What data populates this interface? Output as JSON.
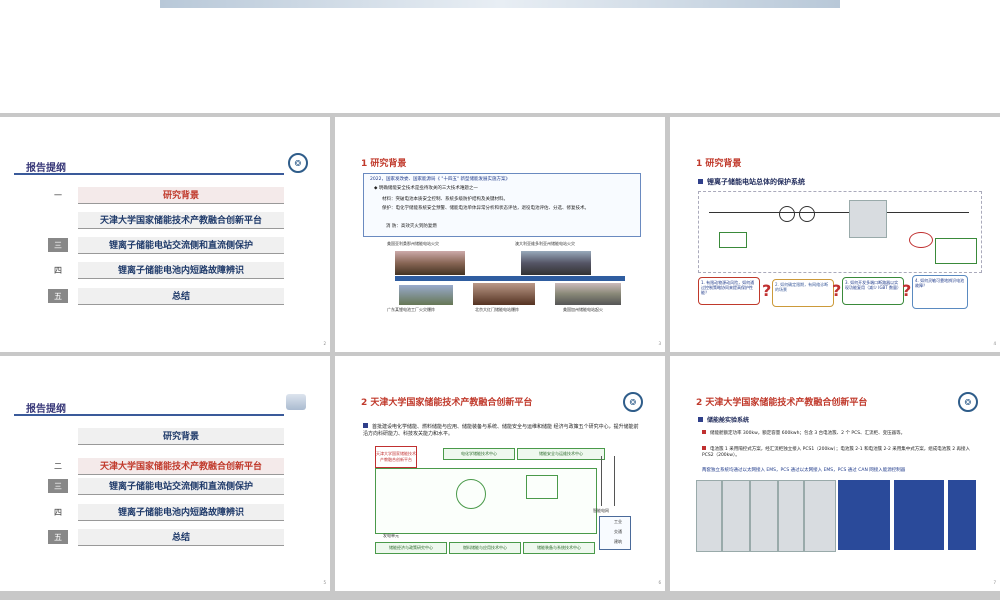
{
  "outline": {
    "title": "报告提纲",
    "items": [
      {
        "num": "一",
        "label": "研究背景"
      },
      {
        "num": "二",
        "label": "天津大学国家储能技术产教融合创新平台"
      },
      {
        "num": "三",
        "label": "锂离子储能电站交流侧和直流侧保护"
      },
      {
        "num": "四",
        "label": "锂离子储能电池内短路故障辨识"
      },
      {
        "num": "五",
        "label": "总结"
      }
    ]
  },
  "slide2": {
    "title": "1 研究背景",
    "policy_line": "2022，国家发改委、国家能源局《 \"十四五\" 新型储能发展实施方案》",
    "bullet1": "◆ 明确储能安全技术是亟待攻关的三大技术难题之一",
    "material": "材料：突破电池本质安全控制、系统多级防护结构及关键材料。",
    "protect": "保护：电化学储能系统安全预警、储能电池单体异常分析和状态评估，退役电池评估、分选、修复技术。",
    "fire": "消 防：高效灭火到防复燃",
    "caps": [
      "美国亚利桑那州储能电站火灾",
      "澳大利亚维多利亚州储能电站火灾",
      "广东某锂电池工厂火灾爆炸",
      "北京大红门储能电站爆炸",
      "美国加州储能电站起火"
    ],
    "page": "3"
  },
  "slide3": {
    "title": "1 研究背景",
    "subtitle": "锂离子储能电站总体的保护系统",
    "bubbles": [
      "1. 有限动物源动风险，如何通过控制策略协同来提高保护性能？",
      "2. 如何确定限期，有网络诊断的场景",
      "3. 如何开发多端口断路器以实现功能复用（减少 IGBT 数量）",
      "4. 如何灵敏可靠地辨识电池故障？"
    ],
    "page": "4"
  },
  "slide5": {
    "title": "2 天津大学国家储能技术产教融合创新平台",
    "desc": "首批建设电化学储能、燃料储能与应用、储能装备与系统、储能安全与运维和储能 经济与政策五个研究中心，提升储能前沿方向科研能力、科技攻关能力和水平。",
    "platform": "天津大学国家储能技术产教融合创新平台",
    "centers": [
      "电化学储能技术中心",
      "储能安全与运维技术中心",
      "储能经济与政策研究中心",
      "燃料储能与应用技术中心",
      "储能装备与系统技术中心"
    ],
    "labels": [
      "发电单元",
      "智能电网",
      "工业",
      "交通",
      "建筑"
    ],
    "page": "6"
  },
  "slide6": {
    "title": "2 天津大学国家储能技术产教融合创新平台",
    "subtitle": "储能舱实验系统",
    "line1": "储能舱额定功率 300kw，额定容量 600kwh；包含 3 台电池簇、2 个 PCS、汇流柜、变压器等。",
    "line2": "电池簇 1 采用隔控式方案，经汇流柜独立接入 PCS1（200kw）；电池簇 2-1 和电池簇 2-2 采用集中式方案，组成电池簇 2 再接入 PCS2（200kw）。",
    "line3": "两套独立系统均通过以太网接入 EMS，PCS 通过以太网接入 EMS，PCS 通过 CAN 网接入能源控制器",
    "page": "7"
  },
  "colors": {
    "accent_red": "#c0392b",
    "navy": "#2f3f8a",
    "outline_grey": "#888888"
  }
}
